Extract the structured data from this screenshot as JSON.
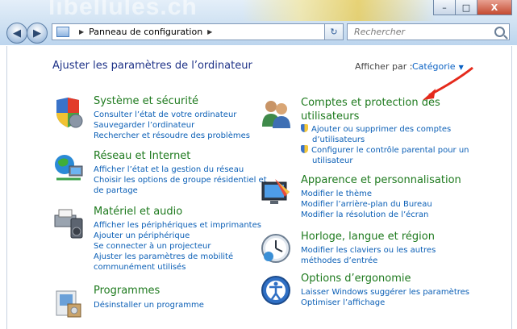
{
  "window": {
    "title_bg_text": "libellules.ch",
    "buttons": {
      "minimize": "–",
      "maximize": "□",
      "close": "X"
    }
  },
  "nav": {
    "back_glyph": "◀",
    "forward_glyph": "▶",
    "address": {
      "crumb": "Panneau de configuration",
      "sep1": "▶",
      "sep2": "▶",
      "drop": "▼"
    },
    "refresh_glyph": "↻",
    "search_placeholder": "Rechercher"
  },
  "content": {
    "title": "Ajuster les paramètres de l’ordinateur",
    "view_label": "Afficher par :",
    "view_value": "Catégorie",
    "view_caret": "▼"
  },
  "categories": [
    {
      "title": "Système et sécurité",
      "links": [
        "Consulter l’état de votre ordinateur",
        "Sauvegarder l’ordinateur",
        "Rechercher et résoudre des problèmes"
      ]
    },
    {
      "title": "Réseau et Internet",
      "links": [
        "Afficher l’état et la gestion du réseau",
        "Choisir les options de groupe résidentiel et",
        "de partage"
      ]
    },
    {
      "title": "Matériel et audio",
      "links": [
        "Afficher les périphériques et imprimantes",
        "Ajouter un périphérique",
        "Se connecter à un projecteur",
        "Ajuster les paramètres de mobilité",
        "communément utilisés"
      ]
    },
    {
      "title": "Programmes",
      "links": [
        "Désinstaller un programme"
      ]
    },
    {
      "title_lines": [
        "Comptes et protection des",
        "utilisateurs"
      ],
      "links": [
        "Ajouter ou supprimer des comptes",
        "d’utilisateurs",
        "Configurer le contrôle parental pour un",
        "utilisateur"
      ]
    },
    {
      "title": "Apparence et personnalisation",
      "links": [
        "Modifier le thème",
        "Modifier l’arrière-plan du Bureau",
        "Modifier la résolution de l’écran"
      ]
    },
    {
      "title": "Horloge, langue et région",
      "links": [
        "Modifier les claviers ou les autres",
        "méthodes d’entrée"
      ]
    },
    {
      "title": "Options d’ergonomie",
      "links": [
        "Laisser Windows suggérer les paramètres",
        "Optimiser l’affichage"
      ]
    }
  ],
  "colors": {
    "title_blue": "#1e3287",
    "category_green": "#1e7a1e",
    "link_blue": "#0b5fb6",
    "annotation_arrow": "#e52a1c"
  }
}
